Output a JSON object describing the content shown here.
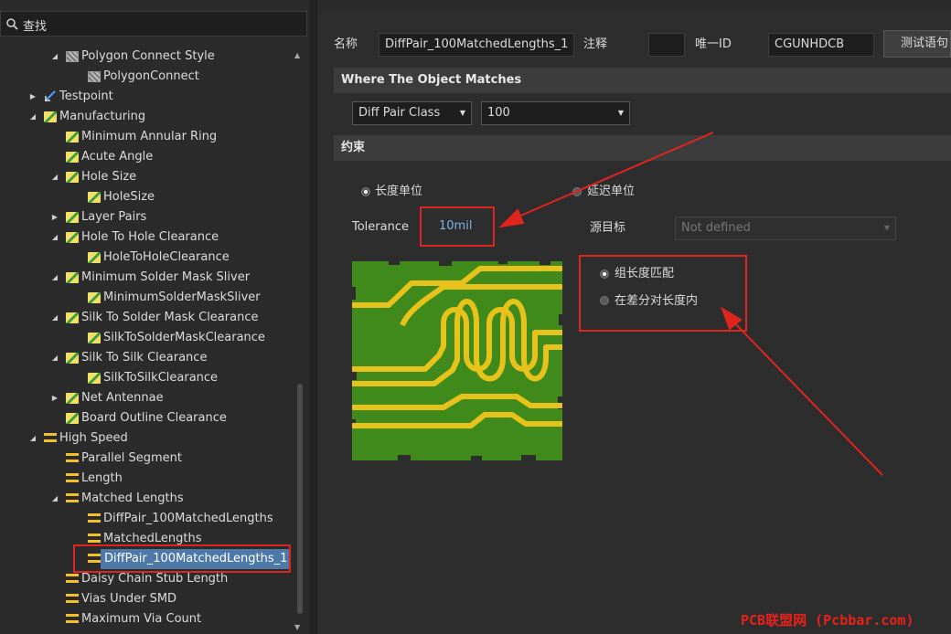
{
  "search": {
    "label": "查找"
  },
  "tree": {
    "items": [
      {
        "label": "Polygon Connect Style",
        "icon": "polygon-icon"
      },
      {
        "label": "PolygonConnect",
        "icon": "polygon-icon"
      },
      {
        "label": "Testpoint",
        "icon": "testpoint-icon"
      },
      {
        "label": "Manufacturing",
        "icon": "rule-icon"
      },
      {
        "label": "Minimum Annular Ring",
        "icon": "rule-icon"
      },
      {
        "label": "Acute Angle",
        "icon": "rule-icon"
      },
      {
        "label": "Hole Size",
        "icon": "rule-icon"
      },
      {
        "label": "HoleSize",
        "icon": "rule-icon"
      },
      {
        "label": "Layer Pairs",
        "icon": "rule-icon"
      },
      {
        "label": "Hole To Hole Clearance",
        "icon": "rule-icon"
      },
      {
        "label": "HoleToHoleClearance",
        "icon": "rule-icon"
      },
      {
        "label": "Minimum Solder Mask Sliver",
        "icon": "rule-icon"
      },
      {
        "label": "MinimumSolderMaskSliver",
        "icon": "rule-icon"
      },
      {
        "label": "Silk To Solder Mask Clearance",
        "icon": "rule-icon"
      },
      {
        "label": "SilkToSolderMaskClearance",
        "icon": "rule-icon"
      },
      {
        "label": "Silk To Silk Clearance",
        "icon": "rule-icon"
      },
      {
        "label": "SilkToSilkClearance",
        "icon": "rule-icon"
      },
      {
        "label": "Net Antennae",
        "icon": "rule-icon"
      },
      {
        "label": "Board Outline Clearance",
        "icon": "rule-icon"
      },
      {
        "label": "High Speed",
        "icon": "high-speed-icon"
      },
      {
        "label": "Parallel Segment",
        "icon": "high-speed-icon"
      },
      {
        "label": "Length",
        "icon": "high-speed-icon"
      },
      {
        "label": "Matched Lengths",
        "icon": "high-speed-icon"
      },
      {
        "label": "DiffPair_100MatchedLengths",
        "icon": "high-speed-icon"
      },
      {
        "label": "MatchedLengths",
        "icon": "high-speed-icon"
      },
      {
        "label": "DiffPair_100MatchedLengths_1",
        "icon": "high-speed-icon"
      },
      {
        "label": "Daisy Chain Stub Length",
        "icon": "high-speed-icon"
      },
      {
        "label": "Vias Under SMD",
        "icon": "high-speed-icon"
      },
      {
        "label": "Maximum Via Count",
        "icon": "high-speed-icon"
      }
    ]
  },
  "header": {
    "name_label": "名称",
    "name_value": "DiffPair_100MatchedLengths_1",
    "comment_label": "注释",
    "comment_value": "",
    "uid_label": "唯一ID",
    "uid_value": "CGUNHDCB",
    "test_button": "测试语句"
  },
  "where": {
    "title": "Where The Object Matches",
    "combo1": "Diff Pair Class",
    "combo2": "100"
  },
  "constraints": {
    "title": "约束",
    "radio_length_unit": "长度单位",
    "radio_delay_unit": "延迟单位",
    "tolerance_label": "Tolerance",
    "tolerance_value": "10mil",
    "source_target_label": "源目标",
    "source_target_value": "Not defined",
    "radio_group_match": "组长度匹配",
    "radio_within_pair": "在差分对长度内"
  },
  "watermark": "PCB联盟网 (Pcbbar.com)",
  "colors": {
    "board": "#3f8a1a",
    "trace": "#e6c21a",
    "highlight": "#e0241e",
    "selection": "#4c79a8"
  }
}
